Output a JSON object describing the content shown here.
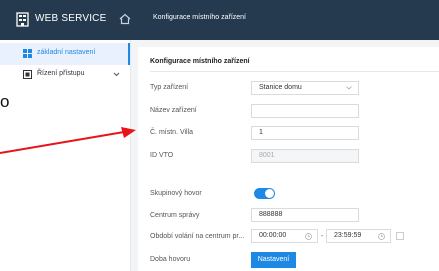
{
  "header": {
    "brand": "WEB SERVICE",
    "breadcrumb": "Konfigurace místního zařízení"
  },
  "sidebar": {
    "items": [
      {
        "label": "základní nastavení",
        "active": true
      },
      {
        "label": "Řízení přístupu",
        "active": false
      }
    ]
  },
  "panel": {
    "title": "Konfigurace místního zařízení",
    "fields": {
      "device_type": {
        "label": "Typ zařízení",
        "value": "Stanice domu"
      },
      "device_name": {
        "label": "Název zařízení",
        "value": ""
      },
      "villa_no": {
        "label": "Č. místn. Villa",
        "value": "1"
      },
      "vto_id": {
        "label": "ID VTO",
        "value": "8001"
      },
      "group_call": {
        "label": "Skupinový hovor",
        "enabled": true
      },
      "management_center": {
        "label": "Centrum správy",
        "value": "888888"
      },
      "call_period": {
        "label": "Období volání na centrum pr...",
        "from": "00:00:00",
        "to": "23:59:59",
        "checked": false
      },
      "call_duration": {
        "label": "Doba hovoru",
        "button": "Nastavení"
      }
    }
  },
  "annotation": {
    "text": "o",
    "arrow_color": "#e8141b"
  },
  "colors": {
    "topbar": "#263a4f",
    "accent": "#1e88e5"
  }
}
